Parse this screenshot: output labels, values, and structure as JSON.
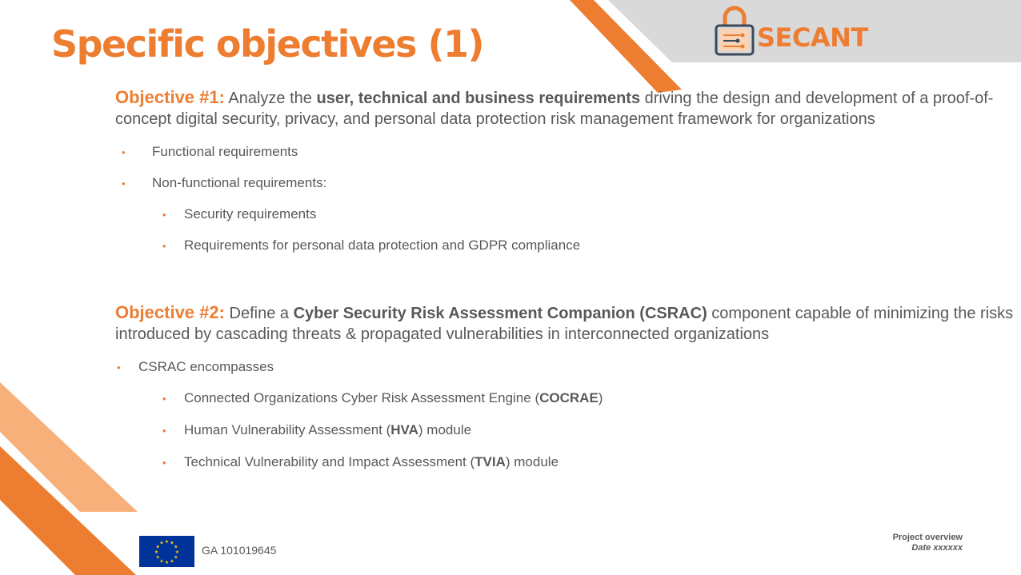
{
  "slide": {
    "title": "Specific objectives (1)"
  },
  "logo": {
    "text": "SECANT",
    "icon": "padlock-circuit-icon"
  },
  "objective1": {
    "label": "Objective #1:",
    "text_a": " Analyze the ",
    "bold": "user, technical and business requirements",
    "text_b": " driving the design and development of a proof-of-concept digital security, privacy, and personal data protection risk management framework for organizations",
    "bullets": [
      {
        "text": "Functional requirements"
      },
      {
        "text": "Non-functional requirements:"
      }
    ],
    "sub_bullets": [
      {
        "text": "Security requirements"
      },
      {
        "text": "Requirements for personal data protection and GDPR compliance"
      }
    ]
  },
  "objective2": {
    "label": "Objective #2:",
    "text_a": " Define a ",
    "bold": "Cyber Security Risk Assessment Companion (CSRAC)",
    "text_b": " component capable of minimizing the risks introduced by cascading threats & propagated vulnerabilities in interconnected organizations",
    "bullet": "CSRAC encompasses",
    "sub_bullets": [
      {
        "pre": "Connected Organizations Cyber Risk Assessment Engine (",
        "bold": "COCRAE",
        "post": ")"
      },
      {
        "pre": "Human Vulnerability Assessment (",
        "bold": "HVA",
        "post": ") module"
      },
      {
        "pre": "Technical Vulnerability and Impact Assessment (",
        "bold": "TVIA",
        "post": ") module"
      }
    ]
  },
  "footer": {
    "grant": "GA 101019645",
    "title": "Project overview",
    "date": "Date xxxxxx",
    "flag_icon": "eu-flag-icon"
  },
  "colors": {
    "accent": "#ed7d31",
    "accent_light": "#f8b07a",
    "header_gray": "#d9d9d9",
    "text": "#595959",
    "eu_blue": "#003399",
    "eu_star": "#ffcc00"
  }
}
